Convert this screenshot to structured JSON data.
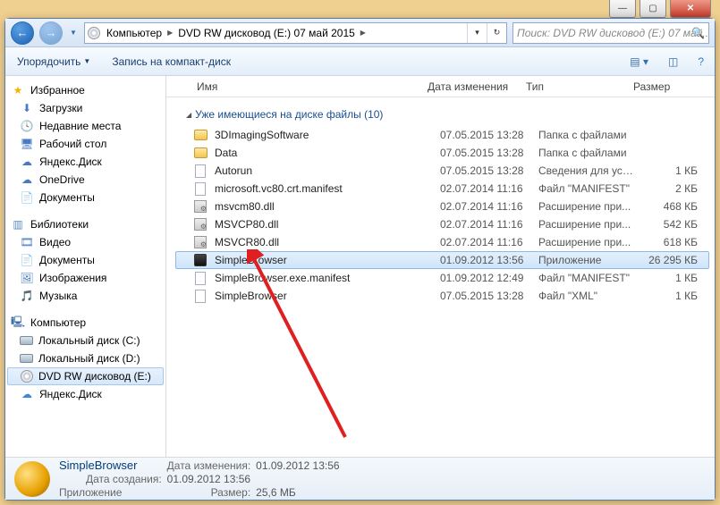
{
  "caption": {
    "min": "—",
    "max": "▢",
    "close": "✕"
  },
  "nav": {
    "back": "←",
    "fwd": "→"
  },
  "breadcrumb": {
    "root": "Компьютер",
    "loc": "DVD RW дисковод (E:) 07 май 2015"
  },
  "search": {
    "placeholder": "Поиск: DVD RW дисковод (E:) 07 май..."
  },
  "toolbar": {
    "organize": "Упорядочить",
    "burn": "Запись на компакт-диск"
  },
  "columns": {
    "name": "Имя",
    "date": "Дата изменения",
    "type": "Тип",
    "size": "Размер"
  },
  "tree": {
    "fav": "Избранное",
    "fav_items": [
      "Загрузки",
      "Недавние места",
      "Рабочий стол",
      "Яндекс.Диск",
      "OneDrive",
      "Документы"
    ],
    "lib": "Библиотеки",
    "lib_items": [
      "Видео",
      "Документы",
      "Изображения",
      "Музыка"
    ],
    "pc": "Компьютер",
    "pc_items": [
      "Локальный диск (C:)",
      "Локальный диск (D:)",
      "DVD RW дисковод (E:)",
      "Яндекс.Диск"
    ]
  },
  "section": {
    "title": "Уже имеющиеся на диске файлы (10)"
  },
  "files": [
    {
      "ico": "folder",
      "name": "3DImagingSoftware",
      "date": "07.05.2015 13:28",
      "type": "Папка с файлами",
      "size": ""
    },
    {
      "ico": "folder",
      "name": "Data",
      "date": "07.05.2015 13:28",
      "type": "Папка с файлами",
      "size": ""
    },
    {
      "ico": "file",
      "name": "Autorun",
      "date": "07.05.2015 13:28",
      "type": "Сведения для уст...",
      "size": "1 КБ"
    },
    {
      "ico": "file",
      "name": "microsoft.vc80.crt.manifest",
      "date": "02.07.2014 11:16",
      "type": "Файл \"MANIFEST\"",
      "size": "2 КБ"
    },
    {
      "ico": "dll",
      "name": "msvcm80.dll",
      "date": "02.07.2014 11:16",
      "type": "Расширение при...",
      "size": "468 КБ"
    },
    {
      "ico": "dll",
      "name": "MSVCP80.dll",
      "date": "02.07.2014 11:16",
      "type": "Расширение при...",
      "size": "542 КБ"
    },
    {
      "ico": "dll",
      "name": "MSVCR80.dll",
      "date": "02.07.2014 11:16",
      "type": "Расширение при...",
      "size": "618 КБ"
    },
    {
      "ico": "app",
      "name": "SimpleBrowser",
      "date": "01.09.2012 13:56",
      "type": "Приложение",
      "size": "26 295 КБ",
      "sel": true
    },
    {
      "ico": "file",
      "name": "SimpleBrowser.exe.manifest",
      "date": "01.09.2012 12:49",
      "type": "Файл \"MANIFEST\"",
      "size": "1 КБ"
    },
    {
      "ico": "file",
      "name": "SimpleBrowser",
      "date": "07.05.2015 13:28",
      "type": "Файл \"XML\"",
      "size": "1 КБ"
    }
  ],
  "details": {
    "name": "SimpleBrowser",
    "kind": "Приложение",
    "mod_label": "Дата изменения:",
    "mod": "01.09.2012 13:56",
    "cre_label": "Дата создания:",
    "cre": "01.09.2012 13:56",
    "size_label": "Размер:",
    "size": "25,6 МБ"
  }
}
